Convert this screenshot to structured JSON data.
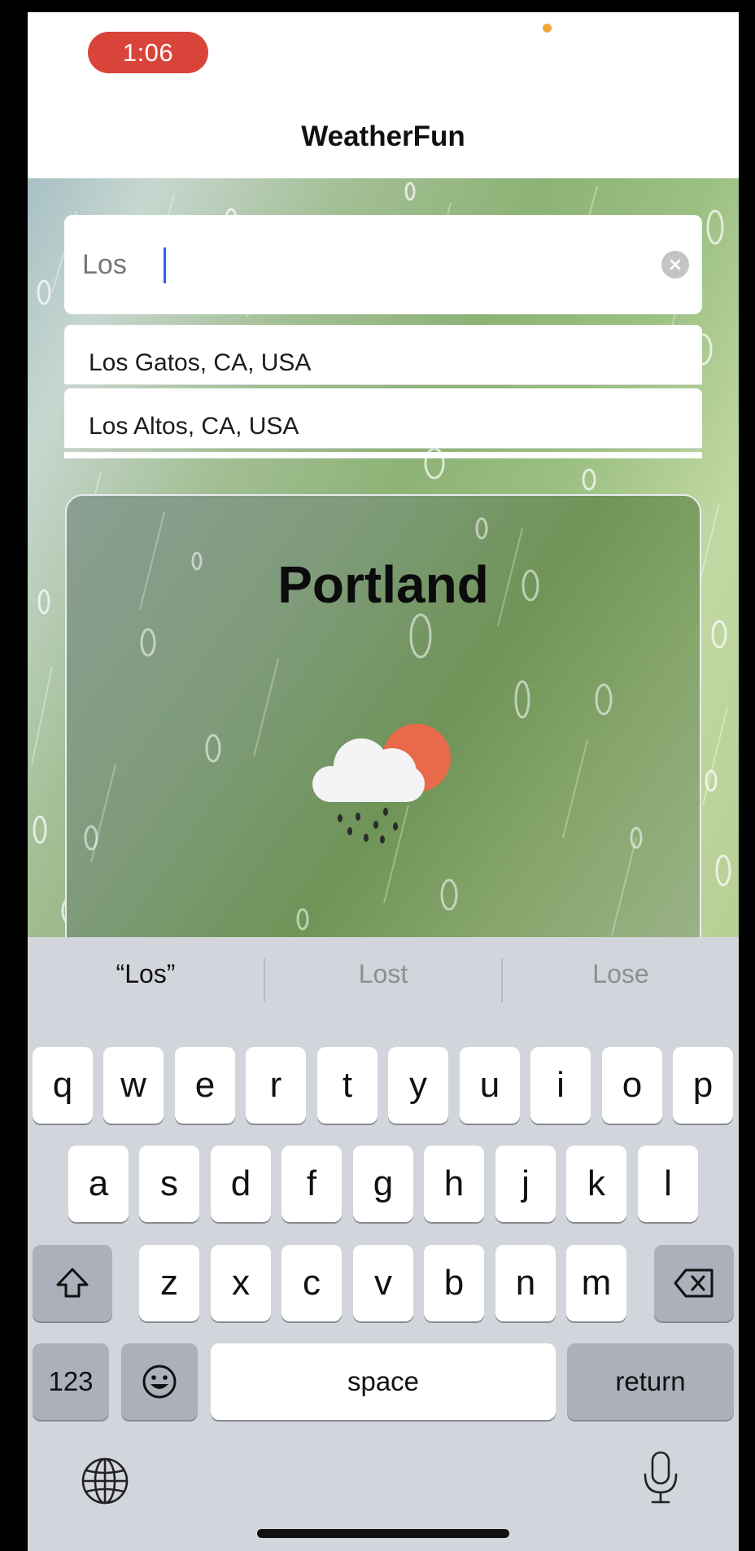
{
  "status_bar": {
    "time": "1:06"
  },
  "nav": {
    "title": "WeatherFun"
  },
  "search": {
    "value": "Los",
    "placeholder": ""
  },
  "suggestions": [
    {
      "label": "Los Gatos, CA, USA"
    },
    {
      "label": "Los Altos, CA, USA"
    }
  ],
  "weather": {
    "city": "Portland",
    "icon": "partly-cloudy-rain-icon"
  },
  "keyboard": {
    "predictions": [
      "“Los”",
      "Lost",
      "Lose"
    ],
    "row1": [
      "q",
      "w",
      "e",
      "r",
      "t",
      "y",
      "u",
      "i",
      "o",
      "p"
    ],
    "row2": [
      "a",
      "s",
      "d",
      "f",
      "g",
      "h",
      "j",
      "k",
      "l"
    ],
    "row3": [
      "z",
      "x",
      "c",
      "v",
      "b",
      "n",
      "m"
    ],
    "numbers_label": "123",
    "space_label": "space",
    "return_label": "return"
  },
  "colors": {
    "time_pill": "#d9443a",
    "caret": "#2f5de6",
    "sun": "#e86a4a",
    "keyboard_bg": "#d2d5db"
  }
}
